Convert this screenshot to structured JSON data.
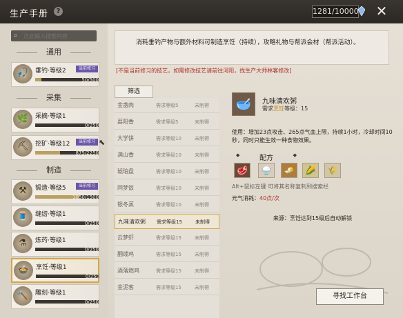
{
  "window": {
    "title": "生产手册",
    "help_icon": "question-icon",
    "energy_counter": "1281/10000",
    "close_icon": "close-icon"
  },
  "sidebar": {
    "search_placeholder": "点此输入搜索内容",
    "groups": [
      "通用",
      "采集",
      "制造"
    ],
    "skills": [
      {
        "name": "垂钓",
        "level": "等级2",
        "badge": "当前修习",
        "progress_label": "50/500",
        "progress": 0.1,
        "icon": "fishing-icon"
      },
      {
        "name": "采摘",
        "level": "等级1",
        "badge": "",
        "progress_label": "0/250",
        "progress": 0.0,
        "icon": "herb-icon"
      },
      {
        "name": "挖矿",
        "level": "等级12",
        "badge": "当前修习",
        "progress_label": "875/2250",
        "progress": 0.39,
        "icon": "pickaxe-icon"
      },
      {
        "name": "锻造",
        "level": "等级5",
        "badge": "当前修习",
        "progress_label": "1050/1500",
        "progress": 0.7,
        "icon": "anvil-icon"
      },
      {
        "name": "缝纫",
        "level": "等级1",
        "badge": "",
        "progress_label": "0/250",
        "progress": 0.0,
        "icon": "needle-icon"
      },
      {
        "name": "炼药",
        "level": "等级1",
        "badge": "",
        "progress_label": "0/250",
        "progress": 0.0,
        "icon": "potion-icon"
      },
      {
        "name": "烹饪",
        "level": "等级1",
        "badge": "",
        "progress_label": "0/250",
        "progress": 0.0,
        "icon": "cooking-icon"
      },
      {
        "name": "雕刻",
        "level": "等级1",
        "badge": "",
        "progress_label": "0/250",
        "progress": 0.0,
        "icon": "chisel-icon"
      }
    ]
  },
  "main": {
    "description": "消耗垂钓产物与额外材料可制造烹饪（持续），攻略礼物与帮派会材（帮派活动）。",
    "warning": "[不是当前修习的技艺，如需修改技艺请前往河阳，找生产大师林客修改]",
    "filter_label": "筛选",
    "recipes": [
      {
        "name": "金盏肉",
        "level": "需求等级5",
        "status": "未制得"
      },
      {
        "name": "荔阳香",
        "level": "需求等级5",
        "status": "未制得"
      },
      {
        "name": "大学饼",
        "level": "需求等级10",
        "status": "未制得"
      },
      {
        "name": "满山香",
        "level": "需求等级10",
        "status": "未制得"
      },
      {
        "name": "琥珀盘",
        "level": "需求等级10",
        "status": "未制得"
      },
      {
        "name": "同梦饭",
        "level": "需求等级10",
        "status": "未制得"
      },
      {
        "name": "银冬蒸",
        "level": "需求等级10",
        "status": "未制得"
      },
      {
        "name": "九味清欢粥",
        "level": "需求等级15",
        "status": "未制得"
      },
      {
        "name": "云梦虾",
        "level": "需求等级15",
        "status": "未制得"
      },
      {
        "name": "翻缕鸡",
        "level": "需求等级15",
        "status": "未制得"
      },
      {
        "name": "酒落燃鸡",
        "level": "需求等级15",
        "status": "未制得"
      },
      {
        "name": "金泥客",
        "level": "需求等级15",
        "status": "未制得"
      }
    ],
    "selected_index": 7
  },
  "detail": {
    "icon": "porridge-bowl-icon",
    "name": "九味清欢粥",
    "requirement_prefix": "需求",
    "requirement_skill": "烹饪",
    "requirement_level": "等级：15",
    "effect": "使用：增加23点攻击、265点气血上限，持续1小时，冷却时间10秒，同时只能生效一种食物效果。",
    "recipe_header": "配方",
    "materials": [
      {
        "name": "material-meat",
        "icon": "meat-icon"
      },
      {
        "name": "material-rice",
        "icon": "rice-icon"
      },
      {
        "name": "material-tofu",
        "icon": "tofu-icon"
      },
      {
        "name": "material-corn",
        "icon": "corn-icon"
      },
      {
        "name": "material-grain",
        "icon": "grain-icon"
      }
    ],
    "material_glyphs": [
      "🥩",
      "🍚",
      "🧈",
      "🌽",
      "🌾"
    ],
    "hint": "Alt+鼠标左键 可将其名称复制到搜索栏",
    "cost_label": "元气消耗：",
    "cost_value": "40点/次",
    "source": "来源：烹饪达到15级后自动解锁",
    "find_button": "寻找工作台"
  },
  "colors": {
    "accent_gold": "#d4a645",
    "badge_purple": "#6a55a8",
    "warning_red": "#b0312a"
  }
}
